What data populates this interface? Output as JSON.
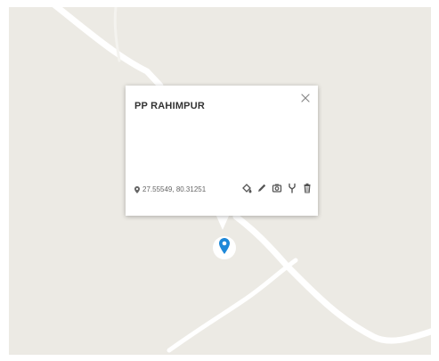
{
  "popup": {
    "title": "PP RAHIMPUR",
    "coordinates": "27.55549, 80.31251",
    "close_icon": "close-icon",
    "actions": [
      "paint-bucket-icon",
      "edit-pencil-icon",
      "camera-icon",
      "fork-icon",
      "trash-icon"
    ]
  },
  "map": {
    "marker_icon": "map-pin-icon",
    "colors": {
      "land": "#eceae4",
      "road": "#ffffff",
      "marker": "#1e88d8"
    }
  }
}
